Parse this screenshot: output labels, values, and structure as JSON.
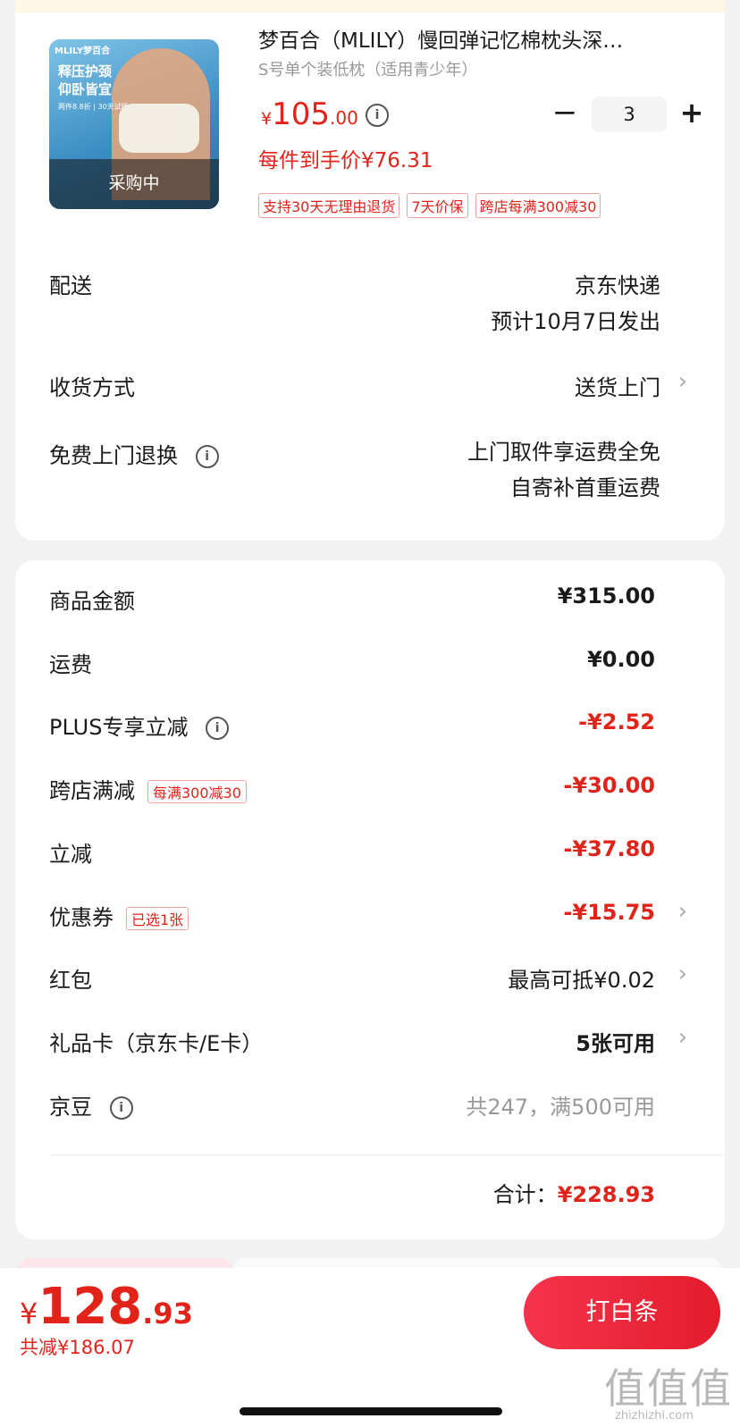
{
  "product": {
    "thumb_brand": "MLILY梦百合",
    "thumb_promo_line1": "释压护颈",
    "thumb_promo_line2": "仰卧皆宜",
    "thumb_promo_small": "两件8.8折 | 30天试睡",
    "thumb_status": "采购中",
    "title": "梦百合（MLILY）慢回弹记忆棉枕头深…",
    "spec": "S号单个装低枕（适用青少年）",
    "price_currency": "¥",
    "price_int": "105",
    "price_dec": ".00",
    "per_unit_price": "每件到手价¥76.31",
    "quantity": "3",
    "minus_symbol": "−",
    "plus_symbol": "+",
    "tags": [
      "支持30天无理由退货",
      "7天价保",
      "跨店每满300减30"
    ]
  },
  "delivery": {
    "label": "配送",
    "value_line1": "京东快递",
    "value_line2": "预计10月7日发出"
  },
  "receive_method": {
    "label": "收货方式",
    "value": "送货上门"
  },
  "free_return": {
    "label": "免费上门退换",
    "value_line1": "上门取件享运费全免",
    "value_line2": "自寄补首重运费"
  },
  "summary": {
    "goods_amount_label": "商品金额",
    "goods_amount": "¥315.00",
    "shipping_label": "运费",
    "shipping": "¥0.00",
    "plus_label": "PLUS专享立减",
    "plus_discount": "-¥2.52",
    "cross_store_label": "跨店满减",
    "cross_store_badge": "每满300减30",
    "cross_store_discount": "-¥30.00",
    "instant_label": "立减",
    "instant_discount": "-¥37.80",
    "coupon_label": "优惠券",
    "coupon_badge": "已选1张",
    "coupon_discount": "-¥15.75",
    "redpacket_label": "红包",
    "redpacket_value": "最高可抵¥0.02",
    "giftcard_label": "礼品卡（京东卡/E卡）",
    "giftcard_value": "5张可用",
    "jingdou_label": "京豆",
    "jingdou_value": "共247，满500可用",
    "total_label": "合计：",
    "total_value": "¥228.93"
  },
  "bottom_bar": {
    "currency": "¥",
    "amount_int": "128",
    "amount_dec": ".93",
    "saved": "共减¥186.07",
    "pay_button": "打白条"
  },
  "watermark": {
    "text": "值值值",
    "url": "zhizhizhi.com"
  },
  "icons": {
    "info": "info-circle-icon",
    "chevron": "chevron-right-icon"
  },
  "colors": {
    "accent_red": "#e2231a",
    "background": "#f2f2f2"
  }
}
